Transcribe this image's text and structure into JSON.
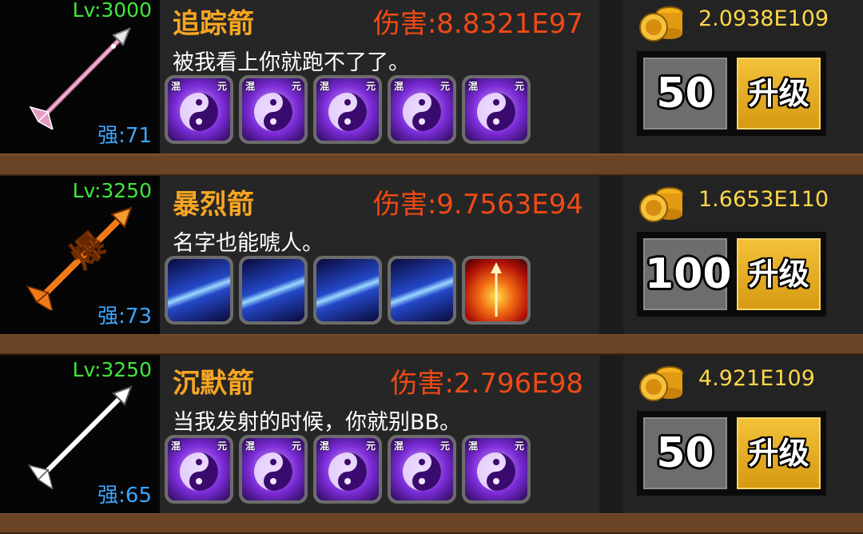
{
  "items": [
    {
      "level": "Lv:3000",
      "strength": "强:71",
      "name": "追踪箭",
      "damage": "伤害:8.8321E97",
      "description": "被我看上你就跑不了了。",
      "skills": [
        {
          "icon": "yin-yang-icon",
          "label_left": "混",
          "label_right": "元"
        },
        {
          "icon": "yin-yang-icon",
          "label_left": "混",
          "label_right": "元"
        },
        {
          "icon": "yin-yang-icon",
          "label_left": "混",
          "label_right": "元"
        },
        {
          "icon": "yin-yang-icon",
          "label_left": "混",
          "label_right": "元"
        },
        {
          "icon": "yin-yang-icon",
          "label_left": "混",
          "label_right": "元"
        }
      ],
      "cost": "2.0938E109",
      "upgrade_count": "50",
      "upgrade_label": "升级"
    },
    {
      "level": "Lv:3250",
      "strength": "强:73",
      "name": "暴烈箭",
      "damage": "伤害:9.7563E94",
      "description": "名字也能唬人。",
      "skills": [
        {
          "icon": "blue-arrow-icon"
        },
        {
          "icon": "blue-arrow-icon"
        },
        {
          "icon": "blue-arrow-icon"
        },
        {
          "icon": "blue-arrow-icon"
        },
        {
          "icon": "fire-arrow-icon"
        }
      ],
      "cost": "1.6653E110",
      "upgrade_count": "100",
      "upgrade_label": "升级"
    },
    {
      "level": "Lv:3250",
      "strength": "强:65",
      "name": "沉默箭",
      "damage": "伤害:2.796E98",
      "description": "当我发射的时候，你就别BB。",
      "skills": [
        {
          "icon": "yin-yang-icon",
          "label_left": "混",
          "label_right": "元"
        },
        {
          "icon": "yin-yang-icon",
          "label_left": "混",
          "label_right": "元"
        },
        {
          "icon": "yin-yang-icon",
          "label_left": "混",
          "label_right": "元"
        },
        {
          "icon": "yin-yang-icon",
          "label_left": "混",
          "label_right": "元"
        },
        {
          "icon": "yin-yang-icon",
          "label_left": "混",
          "label_right": "元"
        }
      ],
      "cost": "4.921E109",
      "upgrade_count": "50",
      "upgrade_label": "升级"
    }
  ],
  "weapon_glyph": "爆",
  "colors": {
    "level": "#3ee83e",
    "strength": "#3aa6ff",
    "name": "#f7a622",
    "damage": "#f04a16",
    "gold": "#ffd84a",
    "upgrade_button": "#e4ac22"
  }
}
